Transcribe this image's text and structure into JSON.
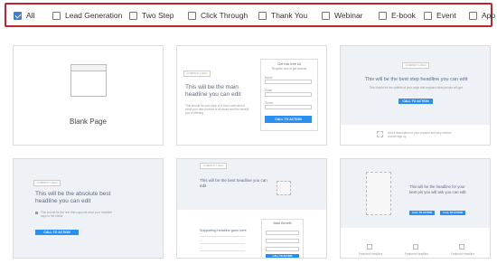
{
  "filters": [
    {
      "label": "All",
      "checked": true
    },
    {
      "label": "Lead Generation",
      "checked": false
    },
    {
      "label": "Two Step",
      "checked": false
    },
    {
      "label": "Click Through",
      "checked": false
    },
    {
      "label": "Thank You",
      "checked": false
    },
    {
      "label": "Webinar",
      "checked": false
    },
    {
      "label": "E-book",
      "checked": false
    },
    {
      "label": "Event",
      "checked": false
    },
    {
      "label": "App",
      "checked": false
    }
  ],
  "cards": {
    "blank": {
      "label": "Blank Page"
    },
    "t2": {
      "tag": "COMPANY LOGO",
      "headline": "This will be the main headline you can edit",
      "body": "This should be your tone of a short overview of what your new product is all about and the benefit you're offering.",
      "form_title": "Get this free kit",
      "form_sub": "Register now to get access",
      "field1": "Name",
      "field2": "Email",
      "field3": "Phone",
      "button": "CALL TO ACTION"
    },
    "t3": {
      "tag": "COMPANY LOGO",
      "headline": "This will be the best step headline you can edit",
      "sub": "This should be the subtitle of your page that explains what people will get.",
      "button": "CALL TO ACTION",
      "note": "Add a description of your product and why visitors should sign up."
    },
    "t4": {
      "tag": "COMPANY LOGO",
      "headline": "This will be the absolute best headline you can edit",
      "bullet": "This should be the text that supports what your headline says to the visitor.",
      "button": "CALL TO ACTION"
    },
    "t5": {
      "tag": "COMPANY LOGO",
      "headline": "This will be the best headline you can edit",
      "sub": "Supporting headline goes here",
      "form_title": "Main Benefit",
      "button": "CALL TO ACTION"
    },
    "t6": {
      "headline": "This will be the headline for your best pin you will ask you can edit",
      "button1": "CALL TO ACTION",
      "button2": "CALL TO ACTION",
      "feature1": "Featured Headline",
      "feature2": "Featured Headline",
      "feature3": "Featured Headline"
    }
  }
}
